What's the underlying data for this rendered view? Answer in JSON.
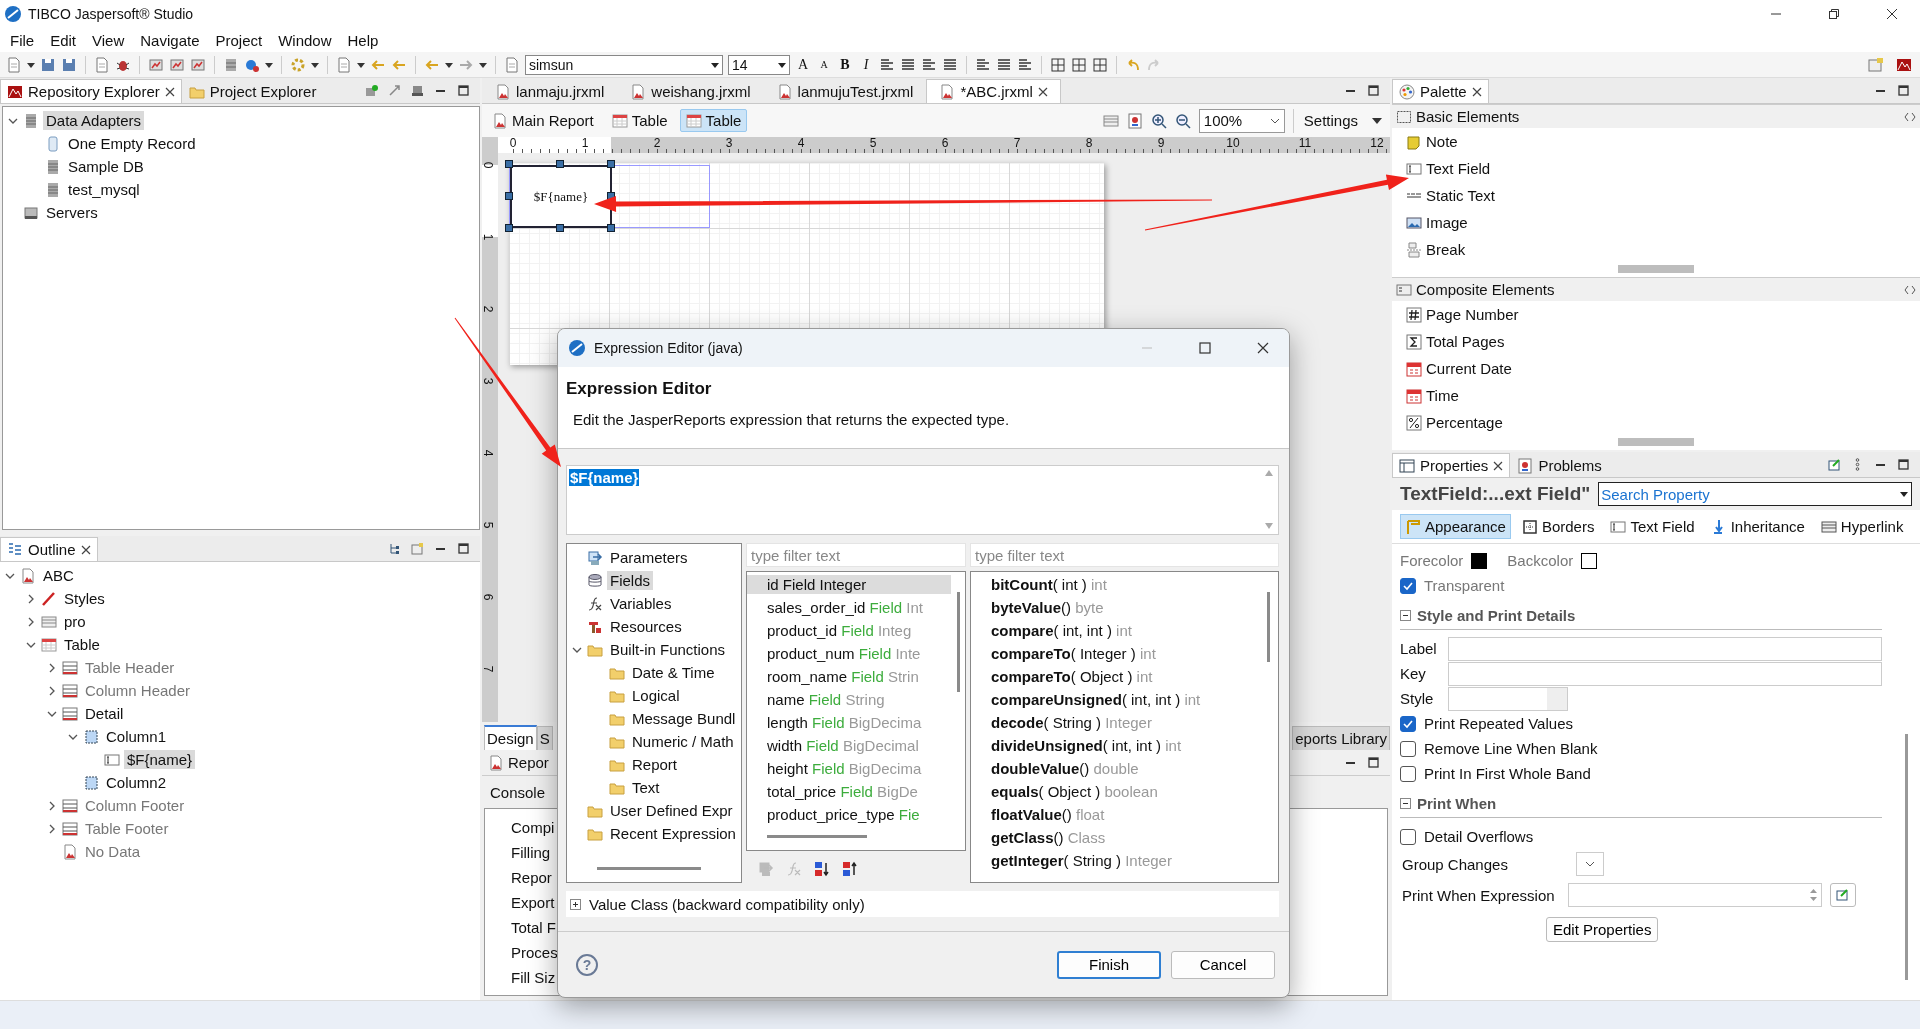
{
  "window": {
    "title": "TIBCO Jaspersoft® Studio"
  },
  "menu": [
    "File",
    "Edit",
    "View",
    "Navigate",
    "Project",
    "Window",
    "Help"
  ],
  "toolbar": {
    "font": "simsun",
    "font_size": "14",
    "text_buttons": [
      {
        "label": "A",
        "kind": "grow"
      },
      {
        "label": "A",
        "kind": "shrink"
      },
      {
        "label": "B",
        "kind": "bold"
      },
      {
        "label": "I",
        "kind": "italic"
      }
    ]
  },
  "repository": {
    "tabs": [
      {
        "label": "Repository Explorer",
        "kind": "jasper",
        "selected": true
      },
      {
        "label": "Project Explorer",
        "kind": "folder",
        "selected": false
      }
    ],
    "tree": [
      {
        "label": "Data Adapters",
        "kind": "database",
        "expanded": true,
        "selected": true,
        "children": [
          {
            "label": "One Empty Record",
            "kind": "record",
            "selected": false
          },
          {
            "label": "Sample DB",
            "kind": "database",
            "selected": false
          },
          {
            "label": "test_mysql",
            "kind": "database",
            "selected": false
          }
        ]
      },
      {
        "label": "Servers",
        "kind": "server",
        "selected": false
      }
    ]
  },
  "outline": {
    "tabs": [
      {
        "label": "Outline",
        "kind": "outline",
        "selected": true
      }
    ],
    "tree": [
      {
        "label": "ABC",
        "kind": "report",
        "expanded": true,
        "selected": false,
        "disabled": false,
        "children": [
          {
            "label": "Styles",
            "kind": "style",
            "expanded": false,
            "selected": false,
            "disabled": false
          },
          {
            "label": "pro",
            "kind": "dataset",
            "expanded": false,
            "selected": false,
            "disabled": false
          },
          {
            "label": "Table",
            "kind": "table",
            "expanded": true,
            "selected": false,
            "disabled": false,
            "children": [
              {
                "label": "Table Header",
                "kind": "band",
                "expanded": false,
                "selected": false,
                "disabled": true
              },
              {
                "label": "Column Header",
                "kind": "band",
                "expanded": false,
                "selected": false,
                "disabled": true
              },
              {
                "label": "Detail",
                "kind": "band",
                "expanded": true,
                "selected": false,
                "disabled": false,
                "children": [
                  {
                    "label": "Column1",
                    "kind": "column",
                    "expanded": true,
                    "selected": false,
                    "disabled": false,
                    "children": [
                      {
                        "label": "$F{name}",
                        "kind": "textfield",
                        "selected": true,
                        "disabled": false
                      }
                    ]
                  },
                  {
                    "label": "Column2",
                    "kind": "column",
                    "selected": false,
                    "disabled": false
                  }
                ]
              },
              {
                "label": "Column Footer",
                "kind": "band",
                "expanded": false,
                "selected": false,
                "disabled": true
              },
              {
                "label": "Table Footer",
                "kind": "band",
                "expanded": false,
                "selected": false,
                "disabled": true
              },
              {
                "label": "No Data",
                "kind": "report",
                "selected": false,
                "disabled": true
              }
            ]
          }
        ]
      }
    ]
  },
  "editor": {
    "tabs": [
      {
        "label": "lanmaju.jrxml",
        "kind": "report",
        "selected": false
      },
      {
        "label": "weishang.jrxml",
        "kind": "report",
        "selected": false
      },
      {
        "label": "lanmujuTest.jrxml",
        "kind": "report",
        "selected": false
      },
      {
        "label": "*ABC.jrxml",
        "kind": "report",
        "selected": true
      }
    ],
    "breadcrumbs": [
      {
        "label": "Main Report",
        "kind": "report",
        "selected": false
      },
      {
        "label": "Table",
        "kind": "table",
        "selected": false
      },
      {
        "label": "Table",
        "kind": "table",
        "selected": true
      }
    ],
    "zoom": "100%",
    "settings": "Settings",
    "ruler": [
      "0",
      "1",
      "2",
      "3",
      "4",
      "5",
      "6",
      "7",
      "8",
      "9",
      "10",
      "11",
      "12"
    ],
    "vertical_ruler": [
      "0",
      "1",
      "2",
      "3",
      "4",
      "5",
      "6",
      "7"
    ],
    "element_text": "$F{name}",
    "bottom_tabs": [
      {
        "label": "Design",
        "selected": true
      },
      {
        "label": "S",
        "selected": false
      },
      {
        "label": "eports Library",
        "selected": false
      }
    ],
    "report_panel": {
      "title": "Repor",
      "console": "Console",
      "items": [
        "Compi",
        "Filling",
        "Repor",
        "Export",
        "Total F",
        "Proces",
        "Fill Siz"
      ]
    }
  },
  "palette": {
    "tabs": [
      {
        "label": "Palette",
        "kind": "palette",
        "selected": true
      }
    ],
    "groups": [
      {
        "title": "Basic Elements",
        "kind": "basic",
        "items": [
          {
            "label": "Note",
            "kind": "note"
          },
          {
            "label": "Text Field",
            "kind": "textfield"
          },
          {
            "label": "Static Text",
            "kind": "statictext"
          },
          {
            "label": "Image",
            "kind": "image"
          },
          {
            "label": "Break",
            "kind": "break"
          }
        ]
      },
      {
        "title": "Composite Elements",
        "kind": "composite",
        "items": [
          {
            "label": "Page Number",
            "kind": "pagenumber"
          },
          {
            "label": "Total Pages",
            "kind": "totalpages"
          },
          {
            "label": "Current Date",
            "kind": "date"
          },
          {
            "label": "Time",
            "kind": "date"
          },
          {
            "label": "Percentage",
            "kind": "percent"
          }
        ]
      }
    ]
  },
  "properties": {
    "tabs": [
      {
        "label": "Properties",
        "kind": "properties",
        "selected": true
      },
      {
        "label": "Problems",
        "kind": "problems",
        "selected": false
      }
    ],
    "title": "TextField:...ext Field\"",
    "search": {
      "placeholder": "Search Property"
    },
    "sections": [
      {
        "label": "Appearance",
        "kind": "appearance",
        "selected": true
      },
      {
        "label": "Borders",
        "kind": "borders",
        "selected": false
      },
      {
        "label": "Text Field",
        "kind": "textfield",
        "selected": false
      },
      {
        "label": "Inheritance",
        "kind": "inheritance",
        "selected": false
      },
      {
        "label": "Hyperlink",
        "kind": "hyperlink",
        "selected": false
      }
    ],
    "colors": [
      {
        "label": "Forecolor",
        "color": "#000000"
      },
      {
        "label": "Backcolor",
        "color": "#ffffff"
      }
    ],
    "transparent": {
      "label": "Transparent",
      "checked": true
    },
    "style_group": {
      "title": "Style and Print Details",
      "expanded": true,
      "fields": [
        {
          "label": "Label",
          "kind": "text"
        },
        {
          "label": "Key",
          "kind": "text"
        },
        {
          "label": "Style",
          "kind": "combo"
        }
      ],
      "options": [
        {
          "label": "Print Repeated Values",
          "checked": true
        },
        {
          "label": "Remove Line When Blank",
          "checked": false
        },
        {
          "label": "Print In First Whole Band",
          "checked": false
        }
      ]
    },
    "print_when": {
      "title": "Print When",
      "expanded": true,
      "options": [
        {
          "label": "Detail Overflows",
          "checked": false
        }
      ],
      "group_changes": "Group Changes",
      "expression": "Print When Expression",
      "button": "Edit Properties"
    }
  },
  "dialog": {
    "title": "Expression Editor (java)",
    "heading": "Expression Editor",
    "description": "Edit the JasperReports expression that returns the expected type.",
    "expression": {
      "text": "$F{name}",
      "selected": true
    },
    "categories": [
      {
        "label": "Parameters",
        "kind": "parameters",
        "selected": false
      },
      {
        "label": "Fields",
        "kind": "fields",
        "selected": true
      },
      {
        "label": "Variables",
        "kind": "variables",
        "selected": false
      },
      {
        "label": "Resources",
        "kind": "resources",
        "selected": false
      },
      {
        "label": "Built-in Functions",
        "kind": "folder",
        "expanded": true,
        "selected": false,
        "children": [
          {
            "label": "Date & Time",
            "kind": "folder",
            "selected": false
          },
          {
            "label": "Logical",
            "kind": "folder",
            "selected": false
          },
          {
            "label": "Message Bundl",
            "kind": "folder",
            "selected": false
          },
          {
            "label": "Numeric / Math",
            "kind": "folder",
            "selected": false
          },
          {
            "label": "Report",
            "kind": "folder",
            "selected": false
          },
          {
            "label": "Text",
            "kind": "folder",
            "selected": false
          }
        ]
      },
      {
        "label": "User Defined Expr",
        "kind": "folder",
        "selected": false
      },
      {
        "label": "Recent Expression",
        "kind": "folder",
        "selected": false
      }
    ],
    "fields_filter": {
      "placeholder": "type filter text"
    },
    "fields": [
      {
        "name": "id",
        "tag": "Field",
        "type": "Integer",
        "selected": true
      },
      {
        "name": "sales_order_id",
        "tag": "Field",
        "type": "Int",
        "selected": false
      },
      {
        "name": "product_id",
        "tag": "Field",
        "type": "Integ",
        "selected": false
      },
      {
        "name": "product_num",
        "tag": "Field",
        "type": "Inte",
        "selected": false
      },
      {
        "name": "room_name",
        "tag": "Field",
        "type": "Strin",
        "selected": false
      },
      {
        "name": "name",
        "tag": "Field",
        "type": "String",
        "selected": false
      },
      {
        "name": "length",
        "tag": "Field",
        "type": "BigDecima",
        "selected": false
      },
      {
        "name": "width",
        "tag": "Field",
        "type": "BigDecimal",
        "selected": false
      },
      {
        "name": "height",
        "tag": "Field",
        "type": "BigDecima",
        "selected": false
      },
      {
        "name": "total_price",
        "tag": "Field",
        "type": "BigDe",
        "selected": false
      },
      {
        "name": "product_price_type",
        "tag": "Fie",
        "selected": false
      }
    ],
    "methods_filter": {
      "placeholder": "type filter text"
    },
    "methods": [
      {
        "name": "bitCount",
        "params": "( int )",
        "returns": "int"
      },
      {
        "name": "byteValue",
        "params": "()",
        "returns": "byte"
      },
      {
        "name": "compare",
        "params": "( int, int )",
        "returns": "int"
      },
      {
        "name": "compareTo",
        "params": "( Integer )",
        "returns": "int"
      },
      {
        "name": "compareTo",
        "params": "( Object )",
        "returns": "int"
      },
      {
        "name": "compareUnsigned",
        "params": "( int, int )",
        "returns": "int"
      },
      {
        "name": "decode",
        "params": "( String )",
        "returns": "Integer"
      },
      {
        "name": "divideUnsigned",
        "params": "( int, int )",
        "returns": "int"
      },
      {
        "name": "doubleValue",
        "params": "()",
        "returns": "double"
      },
      {
        "name": "equals",
        "params": "( Object )",
        "returns": "boolean"
      },
      {
        "name": "floatValue",
        "params": "()",
        "returns": "float"
      },
      {
        "name": "getClass",
        "params": "()",
        "returns": "Class"
      },
      {
        "name": "getInteger",
        "params": "( String )",
        "returns": "Integer"
      }
    ],
    "value_class": {
      "label": "Value Class (backward compatibility only)",
      "expanded": false
    },
    "help": "?",
    "buttons": [
      {
        "label": "Finish",
        "kind": "default"
      },
      {
        "label": "Cancel",
        "kind": "normal"
      }
    ]
  }
}
